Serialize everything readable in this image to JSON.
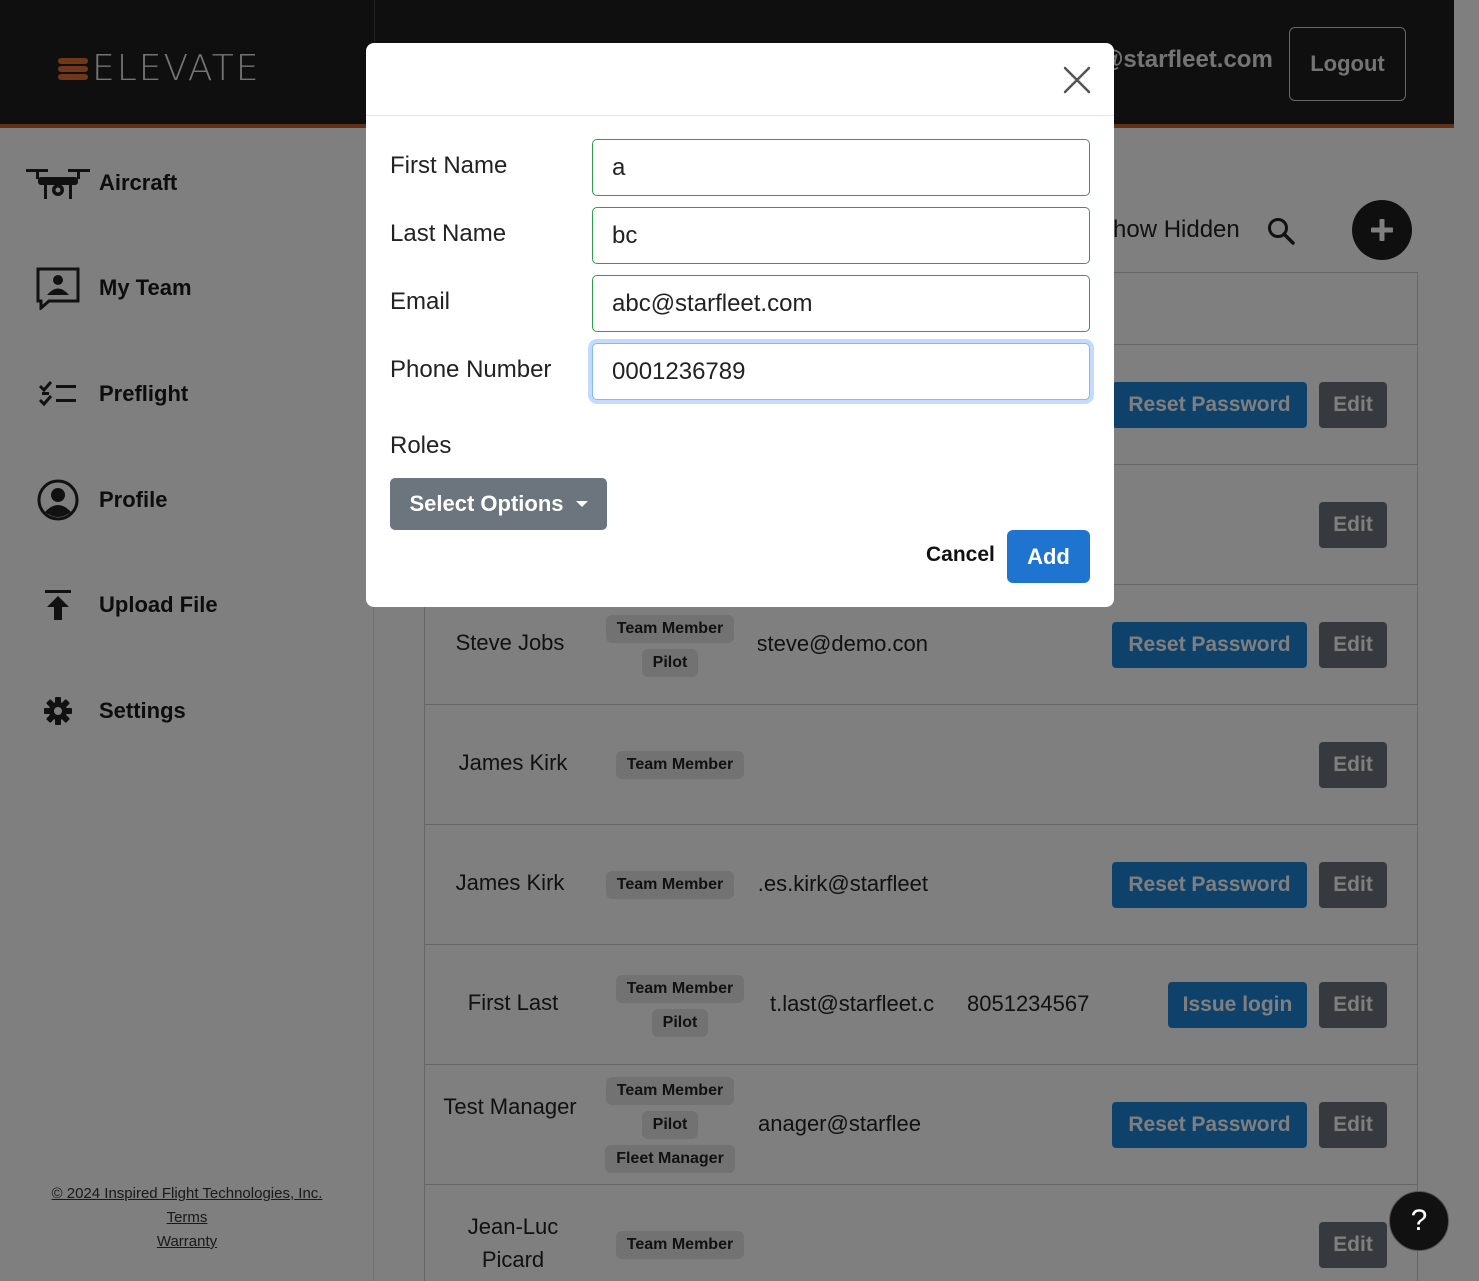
{
  "header": {
    "logo_text": "ELEVATE",
    "user_email": "@starfleet.com",
    "logout_label": "Logout"
  },
  "sidebar": {
    "items": [
      {
        "label": "Aircraft",
        "icon": "drone-icon"
      },
      {
        "label": "My Team",
        "icon": "team-icon"
      },
      {
        "label": "Preflight",
        "icon": "checklist-icon"
      },
      {
        "label": "Profile",
        "icon": "user-circle-icon"
      },
      {
        "label": "Upload File",
        "icon": "upload-icon"
      },
      {
        "label": "Settings",
        "icon": "gear-icon"
      }
    ],
    "footer": {
      "copyright": "© 2024 Inspired Flight Technologies, Inc.",
      "terms": "Terms",
      "warranty": "Warranty"
    }
  },
  "toolbar": {
    "show_hidden_label": "how Hidden"
  },
  "team_table": {
    "rows": [
      {
        "name": "",
        "roles": [],
        "email": "",
        "phone": "",
        "action": "Reset Password",
        "edit": "Edit"
      },
      {
        "name": "",
        "roles": [],
        "email": "",
        "phone": "",
        "action": "",
        "edit": "Edit"
      },
      {
        "name": "Steve Jobs",
        "roles": [
          "Team Member",
          "Pilot"
        ],
        "email": "steve@demo.con",
        "phone": "",
        "action": "Reset Password",
        "edit": "Edit"
      },
      {
        "name": "James Kirk",
        "roles": [
          "Team Member"
        ],
        "email": "",
        "phone": "",
        "action": "",
        "edit": "Edit"
      },
      {
        "name": "James Kirk",
        "roles": [
          "Team Member"
        ],
        "email": "es.kirk@starfleet.",
        "phone": "",
        "action": "Reset Password",
        "edit": "Edit"
      },
      {
        "name": "First Last",
        "roles": [
          "Team Member",
          "Pilot"
        ],
        "email": "t.last@starfleet.c",
        "phone": "8051234567",
        "action": "Issue login",
        "edit": "Edit"
      },
      {
        "name": "Test Manager",
        "roles": [
          "Team Member",
          "Pilot",
          "Fleet Manager"
        ],
        "email": "anager@starflee",
        "phone": "",
        "action": "Reset Password",
        "edit": "Edit"
      },
      {
        "name": "Jean-Luc Picard",
        "roles": [
          "Team Member"
        ],
        "email": "",
        "phone": "",
        "action": "",
        "edit": "Edit"
      }
    ]
  },
  "modal": {
    "fields": {
      "first_name": {
        "label": "First Name",
        "value": "a"
      },
      "last_name": {
        "label": "Last Name",
        "value": "bc"
      },
      "email": {
        "label": "Email",
        "value": "abc@starfleet.com"
      },
      "phone": {
        "label": "Phone Number",
        "value": "0001236789"
      }
    },
    "roles_label": "Roles",
    "select_label": "Select Options",
    "cancel_label": "Cancel",
    "add_label": "Add"
  },
  "help_label": "?",
  "colors": {
    "header_bg": "#1e1e1e",
    "accent_orange": "#c8602a",
    "primary_blue": "#1f84d6",
    "secondary_gray": "#6c757d",
    "valid_green": "#2e9e4a"
  }
}
